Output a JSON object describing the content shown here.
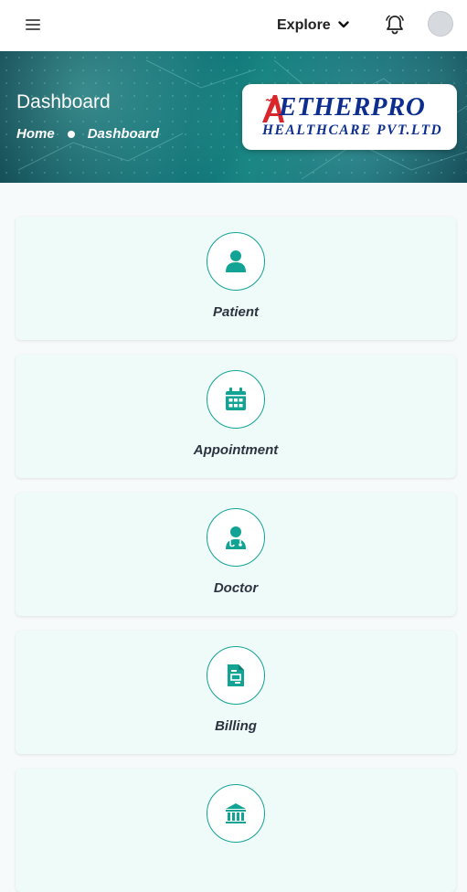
{
  "header": {
    "explore_label": "Explore"
  },
  "hero": {
    "title": "Dashboard",
    "breadcrumb": [
      "Home",
      "Dashboard"
    ]
  },
  "logo": {
    "line1": "ETHERPRO",
    "line2": "HEALTHCARE PVT.LTD"
  },
  "modules": [
    {
      "label": "Patient",
      "icon": "user-icon"
    },
    {
      "label": "Appointment",
      "icon": "calendar-icon"
    },
    {
      "label": "Doctor",
      "icon": "doctor-icon"
    },
    {
      "label": "Billing",
      "icon": "billing-icon"
    },
    {
      "label": "",
      "icon": "bank-icon"
    }
  ],
  "colors": {
    "accent": "#12a395",
    "card_bg": "#eefbf8",
    "logo_blue": "#0d2e8f",
    "logo_red": "#d9262b"
  }
}
